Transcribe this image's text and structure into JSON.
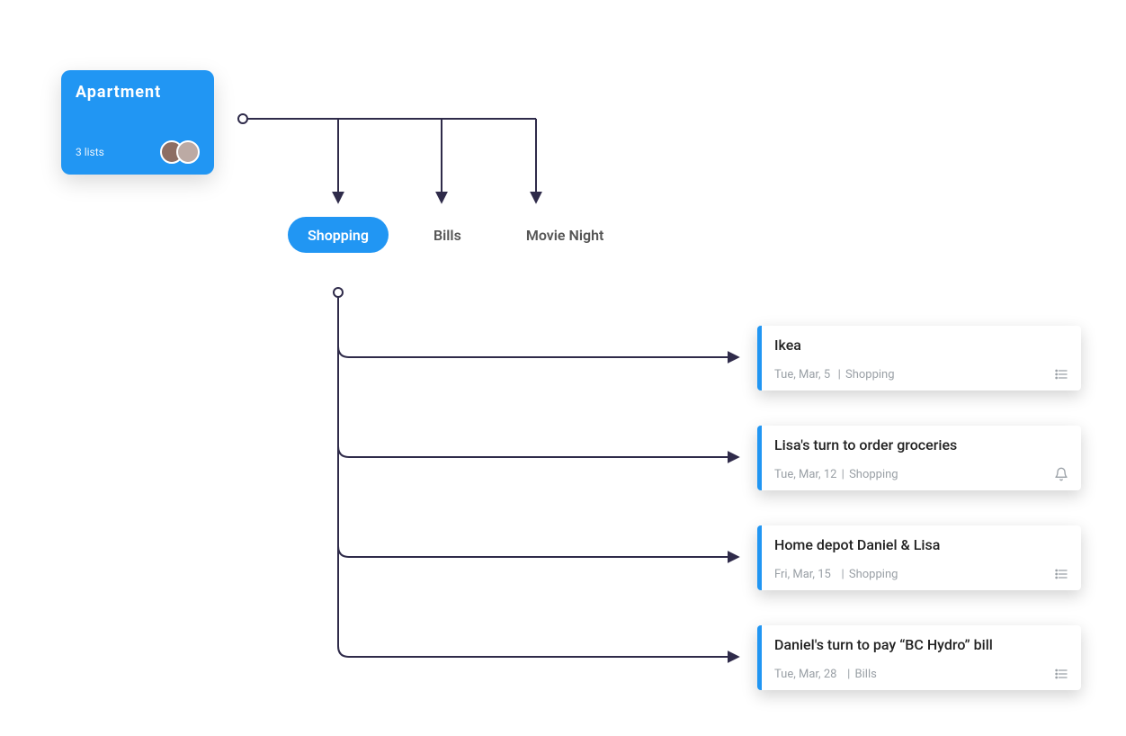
{
  "colors": {
    "accent": "#2196f3",
    "connector": "#2f2b4a",
    "meta": "#9aa0a6"
  },
  "board": {
    "title": "Apartment",
    "subtitle": "3 lists"
  },
  "lists": [
    {
      "label": "Shopping",
      "active": true
    },
    {
      "label": "Bills",
      "active": false
    },
    {
      "label": "Movie Night",
      "active": false
    }
  ],
  "tasks": [
    {
      "title": "Ikea",
      "date": "Tue, Mar, 5",
      "list": "Shopping",
      "icon": "list"
    },
    {
      "title": "Lisa's turn to order groceries",
      "date": "Tue, Mar, 12",
      "list": "Shopping",
      "icon": "bell"
    },
    {
      "title": "Home depot Daniel & Lisa",
      "date": "Fri, Mar, 15",
      "list": "Shopping",
      "icon": "list"
    },
    {
      "title": "Daniel's turn to pay “BC Hydro” bill",
      "date": "Tue, Mar, 28",
      "list": "Bills",
      "icon": "list"
    }
  ]
}
